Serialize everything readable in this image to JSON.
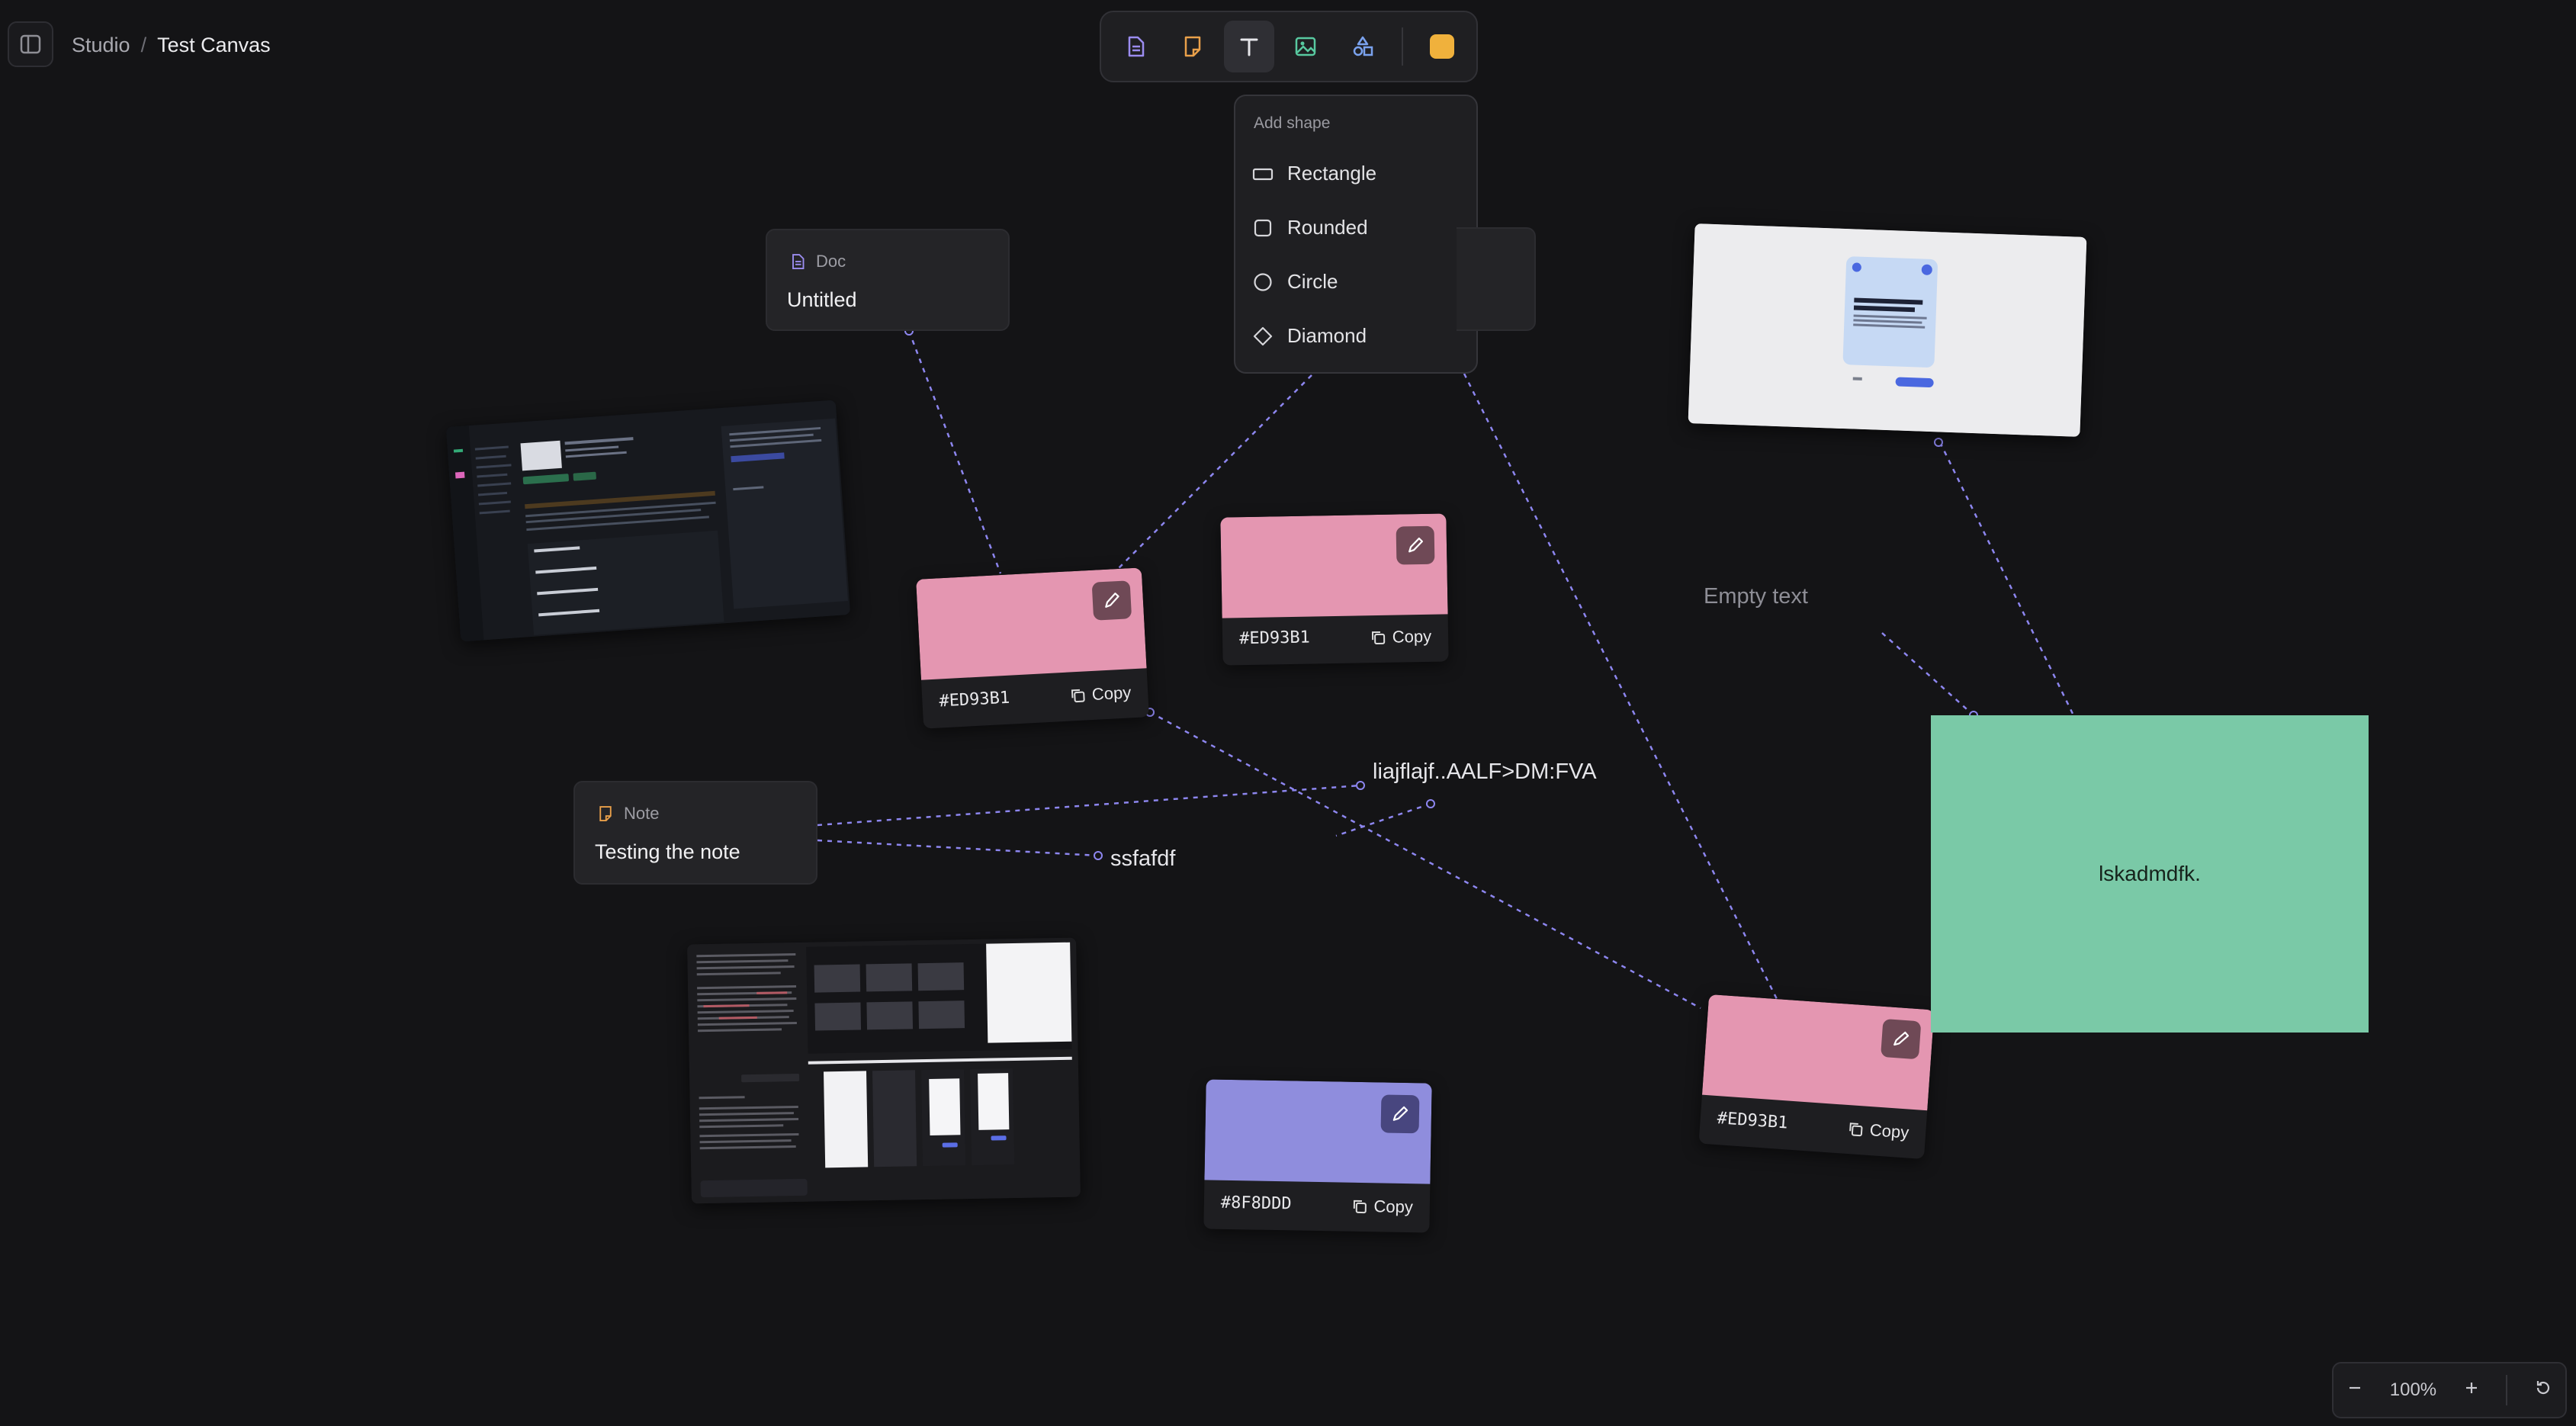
{
  "breadcrumb": {
    "root": "Studio",
    "separator": "/",
    "current": "Test Canvas"
  },
  "toolbar": {
    "tools": [
      "doc-tool-icon",
      "note-tool-icon",
      "text-tool-icon",
      "image-tool-icon",
      "shapes-tool-icon"
    ],
    "active_tool": "text",
    "swatch_color": "#F0B13C"
  },
  "shape_menu": {
    "title": "Add shape",
    "items": [
      "Rectangle",
      "Rounded",
      "Circle",
      "Diamond"
    ]
  },
  "doc_card": {
    "type": "Doc",
    "title": "Untitled"
  },
  "note_card": {
    "type": "Note",
    "title": "Testing the note"
  },
  "color_cards": [
    {
      "hex": "#ED93B1",
      "copy": "Copy"
    },
    {
      "hex": "#ED93B1",
      "copy": "Copy"
    },
    {
      "hex": "#ED93B1",
      "copy": "Copy"
    },
    {
      "hex": "#8F8DDD",
      "copy": "Copy"
    }
  ],
  "texts": {
    "label_a": "liajflajf..AALF>DM:FVA",
    "label_b": "ssfafdf",
    "empty": "Empty text",
    "green_shape": "lskadmdfk."
  },
  "colors": {
    "connector": "#8D86EF",
    "green_shape": "#7AC9A7",
    "pink": "#ED93B1",
    "purple": "#8F8DDD"
  },
  "zoom": {
    "level": "100%"
  }
}
